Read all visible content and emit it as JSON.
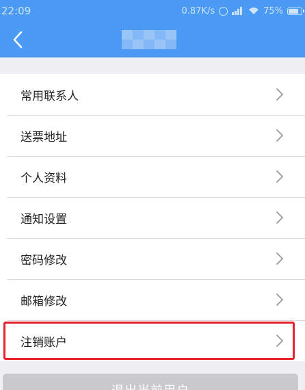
{
  "status_bar": {
    "time": "22:09",
    "net_speed": "0.87K/s",
    "battery": "75%"
  },
  "nav": {
    "back_icon": "chevron-left-icon",
    "title_redacted": true
  },
  "menu": {
    "items": [
      {
        "label": "常用联系人"
      },
      {
        "label": "送票地址"
      },
      {
        "label": "个人资料"
      },
      {
        "label": "通知设置"
      },
      {
        "label": "密码修改"
      },
      {
        "label": "邮箱修改"
      },
      {
        "label": "注销账户",
        "highlighted": true
      }
    ],
    "chevron_icon": "chevron-right-icon"
  },
  "logout": {
    "label": "退出当前用户"
  },
  "colors": {
    "primary": "#4b9bf5",
    "background": "#efeff4",
    "highlight": "#e8202a",
    "logout_button": "#c9c9ce"
  }
}
